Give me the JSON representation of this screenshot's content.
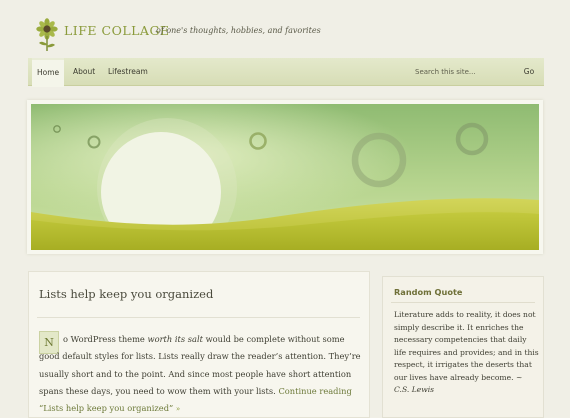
{
  "header": {
    "site_title": "LIFE COLLAGE",
    "tagline": "of one's thoughts, hobbies, and favorites"
  },
  "nav": {
    "items": [
      {
        "label": "Home",
        "active": true
      },
      {
        "label": "About",
        "active": false
      },
      {
        "label": "Lifestream",
        "active": false
      }
    ]
  },
  "search": {
    "placeholder": "Search this site...",
    "go_label": "Go"
  },
  "post": {
    "title": "Lists help keep you organized",
    "dropcap": "N",
    "body_start": "o WordPress theme ",
    "body_emphasis": "worth its salt",
    "body_rest": " would be complete without some good default styles for lists. Lists really draw the reader’s attention. They’re usually short and to the point. And since most people have short attention spans these days, you need to wow them with your lists. ",
    "continue_link": "Continue reading “Lists help keep you organized”",
    "continue_arrow": "»"
  },
  "sidebar": {
    "widget_title": "Random Quote",
    "quote": "Literature adds to reality, it does not simply describe it. It enriches the necessary competencies that daily life requires and provides; and in this respect, it irrigates the deserts that our lives have already become. ~ ",
    "author": "C.S. Lewis"
  },
  "colors": {
    "accent": "#8a9a3a",
    "background": "#f0efe6",
    "nav_bar": "#dde2c1"
  },
  "icons": {
    "logo": "sunflower-logo-icon",
    "continue": "double-chevron-right-icon"
  }
}
